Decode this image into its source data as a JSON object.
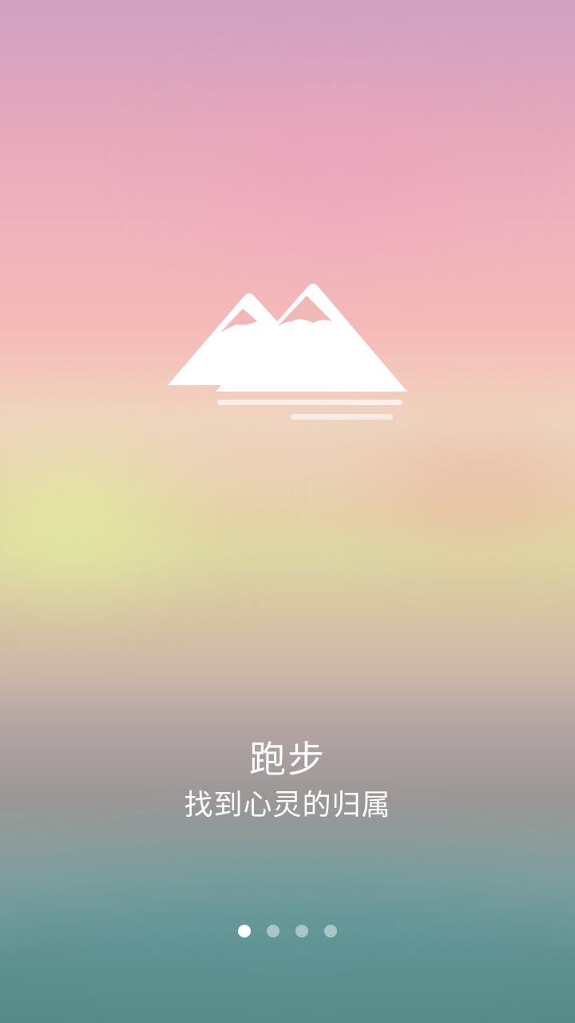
{
  "intro": {
    "title": "跑步",
    "subtitle": "找到心灵的归属"
  },
  "logo": {
    "icon": "mountain-icon",
    "color": "#ffffff"
  },
  "page_indicator": {
    "total": 4,
    "active_index": 0
  }
}
